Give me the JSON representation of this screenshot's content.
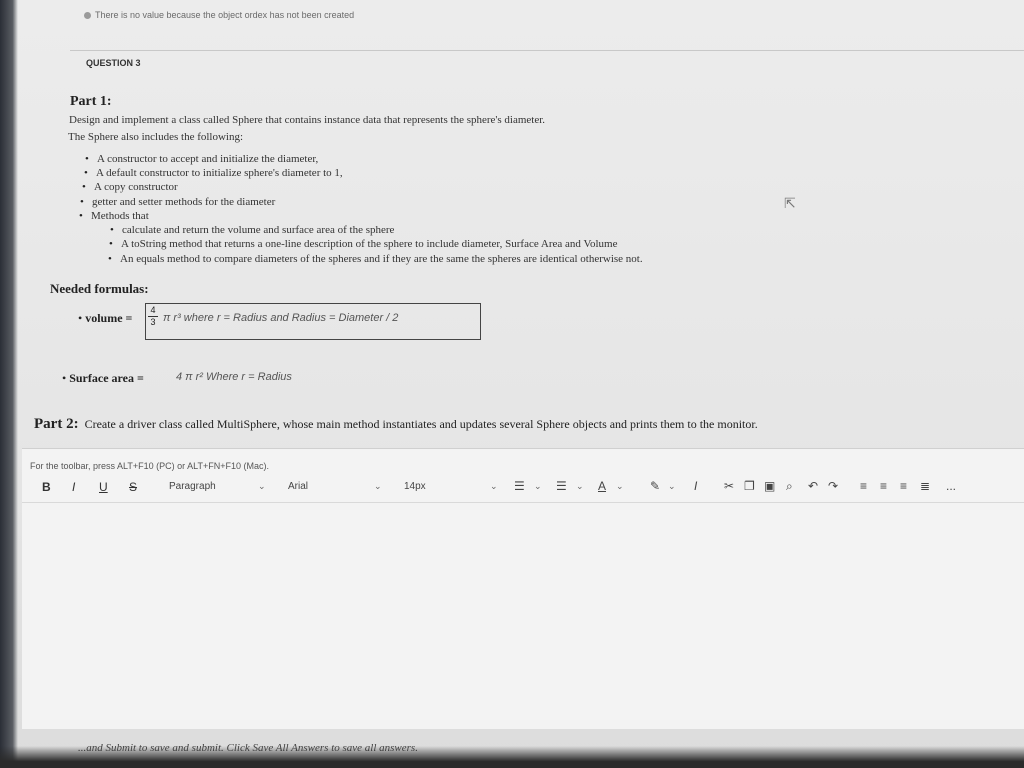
{
  "notice": "There is no value because the object ordex has not been created",
  "question_label": "QUESTION 3",
  "part1": {
    "heading": "Part 1:",
    "intro_1": "Design and implement a class called Sphere that contains instance data that represents the sphere's diameter.",
    "intro_2": "The Sphere also includes the following:",
    "bullets": [
      "A constructor to accept and initialize the diameter,",
      "A default constructor to initialize sphere's diameter to 1,",
      "A copy constructor",
      "getter and setter methods for the diameter",
      "Methods that"
    ],
    "sub_bullets": [
      "calculate and return the volume and surface area of the sphere",
      "A toString method that returns a one-line description of the sphere to include diameter, Surface Area and Volume",
      "An equals method to compare diameters of the spheres and if they are the same the spheres are identical otherwise not."
    ]
  },
  "formulas": {
    "heading": "Needed formulas:",
    "volume_label": "volume =",
    "frac_num": "4",
    "frac_den": "3",
    "volume_expr": "π r³  where r = Radius and Radius = Diameter / 2",
    "sa_label": "Surface area =",
    "sa_expr": "4 π r²  Where r = Radius"
  },
  "part2": {
    "heading": "Part 2:",
    "text": "Create a driver class called MultiSphere, whose main method instantiates and updates several Sphere objects and prints them to the monitor."
  },
  "editor": {
    "toolbar_hint": "For the toolbar, press ALT+F10 (PC) or ALT+FN+F10 (Mac).",
    "bold": "B",
    "italic": "I",
    "underline": "U",
    "strike": "S",
    "paragraph": "Paragraph",
    "font": "Arial",
    "size": "14px",
    "more": "..."
  },
  "footer": "...and Submit to save and submit. Click Save All Answers to save all answers.",
  "icons": [
    "bullet-list-icon",
    "numbered-list-icon",
    "text-color-icon",
    "highlight-icon",
    "clear-format-icon",
    "cut-icon",
    "copy-icon",
    "paste-icon",
    "find-icon",
    "undo-icon",
    "redo-icon",
    "align-left-icon",
    "align-center-icon",
    "align-right-icon",
    "justify-icon",
    "more-icon",
    "cursor-icon"
  ]
}
